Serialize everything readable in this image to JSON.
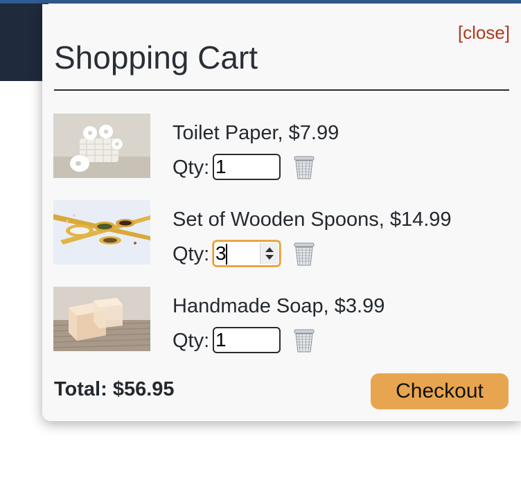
{
  "cart": {
    "close_label": "[close]",
    "title": "Shopping Cart",
    "items": [
      {
        "title": "Toilet Paper, $7.99",
        "qty_label": "Qty:",
        "qty": "1",
        "thumb_icon": "toilet-paper-photo",
        "delete_icon": "trash-can-icon"
      },
      {
        "title": "Set of Wooden Spoons, $14.99",
        "qty_label": "Qty:",
        "qty": "3",
        "thumb_icon": "wooden-spoons-photo",
        "delete_icon": "trash-can-icon"
      },
      {
        "title": "Handmade Soap, $3.99",
        "qty_label": "Qty:",
        "qty": "1",
        "thumb_icon": "handmade-soap-photo",
        "delete_icon": "trash-can-icon"
      }
    ],
    "total": "Total: $56.95",
    "checkout_label": "Checkout"
  },
  "colors": {
    "close_link": "#b0391e",
    "checkout_button": "#e8a54f",
    "focused_input_border": "#e59a2c",
    "panel_background": "#f8f8f8",
    "background_nav": "#1f2a3d",
    "top_accent": "#2f5d93"
  }
}
